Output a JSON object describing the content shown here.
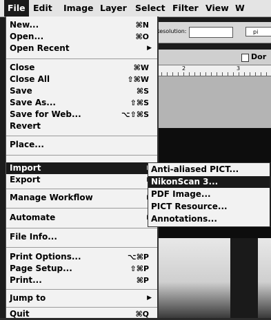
{
  "menubar": {
    "items": [
      "File",
      "Edit",
      "Image",
      "Layer",
      "Select",
      "Filter",
      "View",
      "W"
    ]
  },
  "options_bar": {
    "resolution_label": "Resolution:",
    "units_value": "pi"
  },
  "document": {
    "title": "Dor",
    "ruler_marks": [
      "2",
      "3"
    ]
  },
  "file_menu": {
    "items": [
      {
        "label": "New...",
        "shortcut": "⌘N"
      },
      {
        "label": "Open...",
        "shortcut": "⌘O"
      },
      {
        "label": "Open Recent",
        "submenu": true
      },
      {
        "label": "Close",
        "shortcut": "⌘W"
      },
      {
        "label": "Close All",
        "shortcut": "⇧⌘W"
      },
      {
        "label": "Save",
        "shortcut": "⌘S"
      },
      {
        "label": "Save As...",
        "shortcut": "⇧⌘S"
      },
      {
        "label": "Save for Web...",
        "shortcut": "⌥⇧⌘S"
      },
      {
        "label": "Revert"
      },
      {
        "label": "Place..."
      },
      {
        "label": "Import",
        "submenu": true,
        "highlighted": true
      },
      {
        "label": "Export",
        "submenu": true
      },
      {
        "label": "Manage Workflow",
        "submenu": true
      },
      {
        "label": "Automate",
        "submenu": true
      },
      {
        "label": "File Info..."
      },
      {
        "label": "Print Options...",
        "shortcut": "⌥⌘P"
      },
      {
        "label": "Page Setup...",
        "shortcut": "⇧⌘P"
      },
      {
        "label": "Print...",
        "shortcut": "⌘P"
      },
      {
        "label": "Jump to",
        "submenu": true
      },
      {
        "label": "Quit",
        "shortcut": "⌘Q"
      }
    ]
  },
  "import_submenu": {
    "items": [
      {
        "label": "Anti-aliased PICT..."
      },
      {
        "label": "NikonScan 3...",
        "highlighted": true
      },
      {
        "label": "PDF Image..."
      },
      {
        "label": "PICT Resource..."
      },
      {
        "label": "Annotations..."
      }
    ]
  },
  "colors": {
    "menu_bg": "#f2f2f2",
    "highlight_bg": "#1a1a1a",
    "highlight_text": "#ffffff"
  },
  "icons": {
    "submenu_arrow": "triangle-right-icon",
    "document": "document-icon"
  }
}
